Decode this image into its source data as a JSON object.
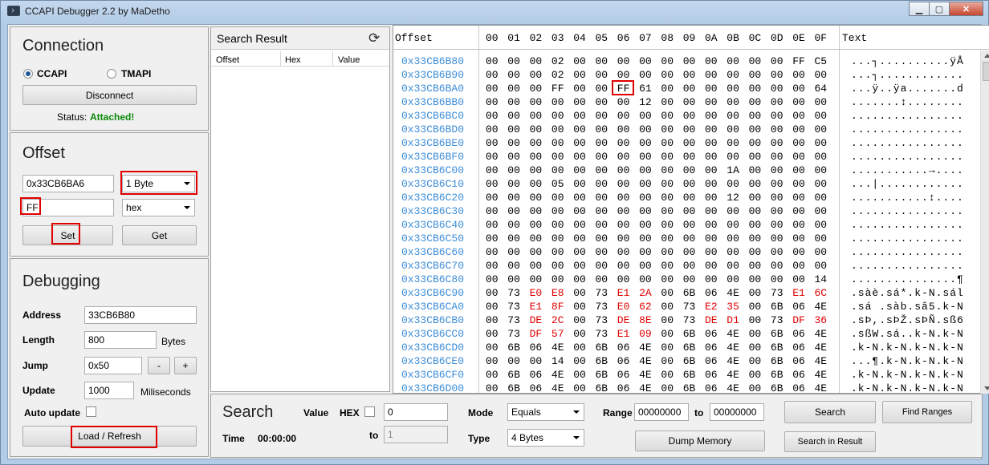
{
  "window": {
    "title": "CCAPI Debugger 2.2 by MaDetho"
  },
  "connection": {
    "heading": "Connection",
    "radio_ccapi": "CCAPI",
    "radio_tmapi": "TMAPI",
    "selected": "CCAPI",
    "disconnect_label": "Disconnect",
    "status_label": "Status:",
    "status_value": "Attached!",
    "status_color": "#0a8a0a"
  },
  "offset": {
    "heading": "Offset",
    "address_value": "0x33CB6BA6",
    "size_value": "1 Byte",
    "value_value": "FF",
    "format_value": "hex",
    "set_label": "Set",
    "get_label": "Get"
  },
  "debugging": {
    "heading": "Debugging",
    "address_label": "Address",
    "address_value": "33CB6B80",
    "length_label": "Length",
    "length_value": "800",
    "length_unit": "Bytes",
    "jump_label": "Jump",
    "jump_value": "0x50",
    "minus": "-",
    "plus": "+",
    "update_label": "Update",
    "update_value": "1000",
    "update_unit": "Miliseconds",
    "auto_update_label": "Auto update",
    "load_label": "Load / Refresh"
  },
  "search_result": {
    "title": "Search Result",
    "refresh_icon": "refresh-icon",
    "col_offset": "Offset",
    "col_hex": "Hex",
    "col_value": "Value"
  },
  "hex": {
    "col_offset": "Offset",
    "col_text": "Text",
    "byte_headers": [
      "00",
      "01",
      "02",
      "03",
      "04",
      "05",
      "06",
      "07",
      "08",
      "09",
      "0A",
      "0B",
      "0C",
      "0D",
      "0E",
      "0F"
    ],
    "highlight_color": "#e00000",
    "offset_color": "#3c8dd8",
    "rows": [
      {
        "offset": "0x33CB6B80",
        "bytes": [
          "00",
          "00",
          "00",
          "02",
          "00",
          "00",
          "00",
          "00",
          "00",
          "00",
          "00",
          "00",
          "00",
          "00",
          "FF",
          "C5"
        ],
        "red": [],
        "text": "...┐..........ÿÅ"
      },
      {
        "offset": "0x33CB6B90",
        "bytes": [
          "00",
          "00",
          "00",
          "02",
          "00",
          "00",
          "00",
          "00",
          "00",
          "00",
          "00",
          "00",
          "00",
          "00",
          "00",
          "00"
        ],
        "red": [],
        "text": "...┐............"
      },
      {
        "offset": "0x33CB6BA0",
        "bytes": [
          "00",
          "00",
          "00",
          "FF",
          "00",
          "00",
          "FF",
          "61",
          "00",
          "00",
          "00",
          "00",
          "00",
          "00",
          "00",
          "64"
        ],
        "red": [],
        "text": "...ÿ..ÿa.......d"
      },
      {
        "offset": "0x33CB6BB0",
        "bytes": [
          "00",
          "00",
          "00",
          "00",
          "00",
          "00",
          "00",
          "12",
          "00",
          "00",
          "00",
          "00",
          "00",
          "00",
          "00",
          "00"
        ],
        "red": [],
        "text": ".......↕........"
      },
      {
        "offset": "0x33CB6BC0",
        "bytes": [
          "00",
          "00",
          "00",
          "00",
          "00",
          "00",
          "00",
          "00",
          "00",
          "00",
          "00",
          "00",
          "00",
          "00",
          "00",
          "00"
        ],
        "red": [],
        "text": "................"
      },
      {
        "offset": "0x33CB6BD0",
        "bytes": [
          "00",
          "00",
          "00",
          "00",
          "00",
          "00",
          "00",
          "00",
          "00",
          "00",
          "00",
          "00",
          "00",
          "00",
          "00",
          "00"
        ],
        "red": [],
        "text": "................"
      },
      {
        "offset": "0x33CB6BE0",
        "bytes": [
          "00",
          "00",
          "00",
          "00",
          "00",
          "00",
          "00",
          "00",
          "00",
          "00",
          "00",
          "00",
          "00",
          "00",
          "00",
          "00"
        ],
        "red": [],
        "text": "................"
      },
      {
        "offset": "0x33CB6BF0",
        "bytes": [
          "00",
          "00",
          "00",
          "00",
          "00",
          "00",
          "00",
          "00",
          "00",
          "00",
          "00",
          "00",
          "00",
          "00",
          "00",
          "00"
        ],
        "red": [],
        "text": "................"
      },
      {
        "offset": "0x33CB6C00",
        "bytes": [
          "00",
          "00",
          "00",
          "00",
          "00",
          "00",
          "00",
          "00",
          "00",
          "00",
          "00",
          "1A",
          "00",
          "00",
          "00",
          "00"
        ],
        "red": [],
        "text": "...........→...."
      },
      {
        "offset": "0x33CB6C10",
        "bytes": [
          "00",
          "00",
          "00",
          "05",
          "00",
          "00",
          "00",
          "00",
          "00",
          "00",
          "00",
          "00",
          "00",
          "00",
          "00",
          "00"
        ],
        "red": [],
        "text": "...|............"
      },
      {
        "offset": "0x33CB6C20",
        "bytes": [
          "00",
          "00",
          "00",
          "00",
          "00",
          "00",
          "00",
          "00",
          "00",
          "00",
          "00",
          "12",
          "00",
          "00",
          "00",
          "00"
        ],
        "red": [],
        "text": "...........↕...."
      },
      {
        "offset": "0x33CB6C30",
        "bytes": [
          "00",
          "00",
          "00",
          "00",
          "00",
          "00",
          "00",
          "00",
          "00",
          "00",
          "00",
          "00",
          "00",
          "00",
          "00",
          "00"
        ],
        "red": [],
        "text": "................"
      },
      {
        "offset": "0x33CB6C40",
        "bytes": [
          "00",
          "00",
          "00",
          "00",
          "00",
          "00",
          "00",
          "00",
          "00",
          "00",
          "00",
          "00",
          "00",
          "00",
          "00",
          "00"
        ],
        "red": [],
        "text": "................"
      },
      {
        "offset": "0x33CB6C50",
        "bytes": [
          "00",
          "00",
          "00",
          "00",
          "00",
          "00",
          "00",
          "00",
          "00",
          "00",
          "00",
          "00",
          "00",
          "00",
          "00",
          "00"
        ],
        "red": [],
        "text": "................"
      },
      {
        "offset": "0x33CB6C60",
        "bytes": [
          "00",
          "00",
          "00",
          "00",
          "00",
          "00",
          "00",
          "00",
          "00",
          "00",
          "00",
          "00",
          "00",
          "00",
          "00",
          "00"
        ],
        "red": [],
        "text": "................"
      },
      {
        "offset": "0x33CB6C70",
        "bytes": [
          "00",
          "00",
          "00",
          "00",
          "00",
          "00",
          "00",
          "00",
          "00",
          "00",
          "00",
          "00",
          "00",
          "00",
          "00",
          "00"
        ],
        "red": [],
        "text": "................"
      },
      {
        "offset": "0x33CB6C80",
        "bytes": [
          "00",
          "00",
          "00",
          "00",
          "00",
          "00",
          "00",
          "00",
          "00",
          "00",
          "00",
          "00",
          "00",
          "00",
          "00",
          "14"
        ],
        "red": [],
        "text": "...............¶"
      },
      {
        "offset": "0x33CB6C90",
        "bytes": [
          "00",
          "73",
          "E0",
          "E8",
          "00",
          "73",
          "E1",
          "2A",
          "00",
          "6B",
          "06",
          "4E",
          "00",
          "73",
          "E1",
          "6C"
        ],
        "red": [
          2,
          3,
          6,
          7,
          14,
          15
        ],
        "text": ".sàè.sá*.k-N.sál"
      },
      {
        "offset": "0x33CB6CA0",
        "bytes": [
          "00",
          "73",
          "E1",
          "8F",
          "00",
          "73",
          "E0",
          "62",
          "00",
          "73",
          "E2",
          "35",
          "00",
          "6B",
          "06",
          "4E"
        ],
        "red": [
          2,
          3,
          6,
          7,
          10,
          11
        ],
        "text": ".sá .sàb.sâ5.k-N"
      },
      {
        "offset": "0x33CB6CB0",
        "bytes": [
          "00",
          "73",
          "DE",
          "2C",
          "00",
          "73",
          "DE",
          "8E",
          "00",
          "73",
          "DE",
          "D1",
          "00",
          "73",
          "DF",
          "36"
        ],
        "red": [
          2,
          3,
          6,
          7,
          10,
          11,
          14,
          15
        ],
        "text": ".sÞ,.sÞŽ.sÞÑ.sß6"
      },
      {
        "offset": "0x33CB6CC0",
        "bytes": [
          "00",
          "73",
          "DF",
          "57",
          "00",
          "73",
          "E1",
          "09",
          "00",
          "6B",
          "06",
          "4E",
          "00",
          "6B",
          "06",
          "4E"
        ],
        "red": [
          2,
          3,
          6,
          7
        ],
        "text": ".sßW.sá..k-N.k-N"
      },
      {
        "offset": "0x33CB6CD0",
        "bytes": [
          "00",
          "6B",
          "06",
          "4E",
          "00",
          "6B",
          "06",
          "4E",
          "00",
          "6B",
          "06",
          "4E",
          "00",
          "6B",
          "06",
          "4E"
        ],
        "red": [],
        "text": ".k-N.k-N.k-N.k-N"
      },
      {
        "offset": "0x33CB6CE0",
        "bytes": [
          "00",
          "00",
          "00",
          "14",
          "00",
          "6B",
          "06",
          "4E",
          "00",
          "6B",
          "06",
          "4E",
          "00",
          "6B",
          "06",
          "4E"
        ],
        "red": [],
        "text": "...¶.k-N.k-N.k-N"
      },
      {
        "offset": "0x33CB6CF0",
        "bytes": [
          "00",
          "6B",
          "06",
          "4E",
          "00",
          "6B",
          "06",
          "4E",
          "00",
          "6B",
          "06",
          "4E",
          "00",
          "6B",
          "06",
          "4E"
        ],
        "red": [],
        "text": ".k-N.k-N.k-N.k-N"
      },
      {
        "offset": "0x33CB6D00",
        "bytes": [
          "00",
          "6B",
          "06",
          "4E",
          "00",
          "6B",
          "06",
          "4E",
          "00",
          "6B",
          "06",
          "4E",
          "00",
          "6B",
          "06",
          "4E"
        ],
        "red": [],
        "text": ".k-N.k-N.k-N.k-N"
      }
    ]
  },
  "search": {
    "heading": "Search",
    "value_label": "Value",
    "hex_label": "HEX",
    "value_input": "0",
    "to_label": "to",
    "to_input": "1",
    "time_label": "Time",
    "time_value": "00:00:00",
    "mode_label": "Mode",
    "mode_value": "Equals",
    "type_label": "Type",
    "type_value": "4 Bytes",
    "range_label": "Range",
    "range_from": "00000000",
    "range_to_label": "to",
    "range_to": "00000000",
    "dump_label": "Dump Memory",
    "search_button": "Search",
    "find_ranges": "Find Ranges",
    "search_in_result": "Search in Result"
  }
}
